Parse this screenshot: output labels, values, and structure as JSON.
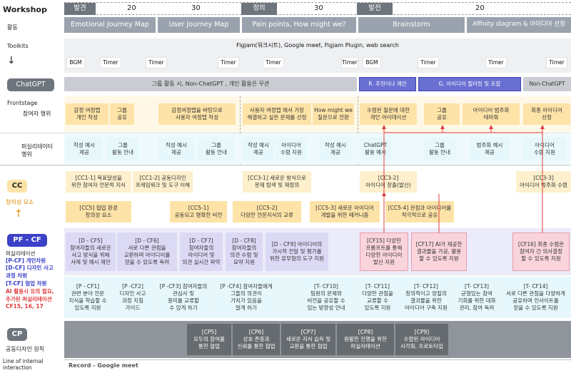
{
  "header": {
    "title": "Workshop",
    "timeline_label": "활동",
    "phases": [
      {
        "name": "발견",
        "minutes": "20",
        "minutes2": "30"
      },
      {
        "name": "정의",
        "minutes": "30"
      },
      {
        "name": "발전",
        "minutes": "20"
      }
    ],
    "activities": [
      "Emotional Journey Map",
      "User Journey Map",
      "Pain points, How might we?",
      "Brainstorm",
      "Affinity diagram & 아이디어 선정"
    ]
  },
  "toolkits": {
    "label": "Toolkits",
    "bar": "Figjam(워크시트), Google meet, Figjam Plugin, web search",
    "bgm": "BGM",
    "timer": "Timer"
  },
  "chatgpt": {
    "label": "ChatGPT",
    "bar": "그룹 활동 시, Non-ChatGPT , 개인 활용은 무관",
    "r": "R. 추천이나 제안",
    "g": "G. 아이디어 필터링 및 조합",
    "non": "Non-ChatGPT"
  },
  "frontstage": {
    "label": "Frontstage",
    "participant_label": "참여자 행위",
    "participant": [
      "감정 여정맵\n개인 작성",
      "그룹\n공유",
      "감정여정맵을 바탕으로\n사용자 여정맵 작성",
      "사용자 여정맵 에서 가장\n해결하고 싶은 문제를 선정",
      "How might we\n질문으로 전환",
      "수렴된 질문에 대한\n개인 아이데이션",
      "그룹\n공유",
      "아이디어 범주화\n테마화",
      "최종 아이디어\n선정"
    ],
    "facilitator_label": "퍼실리테이터\n행위",
    "facilitator": [
      "작성 예시\n제공",
      "그룹\n활동 안내",
      "작성 예시\n제공",
      "그룹\n활동 안내",
      "작성 예시\n제공",
      "아이디어\n수렴 지원",
      "작성 예시\n제공",
      "ChatGPT\n활용 예시",
      "그룹\n활동 안내",
      "범주화 예시\n제공",
      "아이디어\n수렴 지원"
    ]
  },
  "cc": {
    "label": "CC",
    "sublabel": "창의성 요소",
    "row1": [
      "[CC1-1] 목표달성을\n위한 참여자 전문적 지식",
      "[CC1-2] 공동디자인\n프레임워크 및 도구 이해",
      "[CC3-1] 새로운 방식으로\n문제 탐색 및 재정의",
      "[CC3-2]\n아이디어 창출(발산)",
      "[CC3-3]\n아이디어 범주화 수렴"
    ],
    "row2": [
      "[CC5] 협업 환경\n창의성 요소",
      "[CC5-1]\n공동되고 명확한 비전",
      "[CC5-2]\n다양한 전문지식의 교류",
      "[CC5-3] 새로운 아이디어\n개발을 위한 메커니즘",
      "[CC5-4] 관점과 아이디어를\n적극적으로 공유"
    ]
  },
  "pfcf": {
    "label": "PF - CF",
    "legend": [
      {
        "text": "퍼실리테이션",
        "color": "#333333"
      },
      {
        "text": "[P-CF] 개인차원",
        "color": "#3b40c9"
      },
      {
        "text": "[D-CF] 디자인 사고\n과정 차원",
        "color": "#3b40c9"
      },
      {
        "text": "[T-CF] 협업 차원",
        "color": "#3b40c9"
      },
      {
        "text": "AI 활용시 유의 필요,\n추가된 퍼실리테이션\nCF15, 16, 17",
        "color": "#e03c3c"
      }
    ],
    "dcf": [
      "[D - CF5]\n참여자들의 새로운\n사고 방식을 위해\n사례 및 예시 제안",
      "[D - CF6]\n서로 다른 관점을\n교환하며 아이디어를\n얻을 수 있도록 독려",
      "[D - CF7]\n참여자들의\n아이디어 및\n의견 실시간 파악",
      "[D - CF8]\n참여자들의\n의견 수렴 및\n요약 지원",
      "[D - CF9] 아이디어의\n가시적 전달 및 평가를\n위한 유무형의 도구 지원"
    ],
    "cf_ai": [
      "[CF15] 다양한\n프롬프트를 통해\n다양한 아이디어\n발산 지원",
      "[CF17] AI가 제공한\n결과물을 가공, 활용\n할 수 있도록 지원",
      "[CF16] 최종 수렴은\n참여자 간 의사결정\n할 수 있도록 지원"
    ],
    "pcf": [
      "[P - CF1]\n관련 분야 전문\n지식을 학습할 수\n있도록 지원",
      "[P -CF2]\n디자인 사고\n과정 지침\n가이드",
      "[P -CF3] 참여자들의\n관심사 및\n흥미를 교류할\n수 있게 하기",
      "[P -CF4] 참여자들에게\n그들의 의견이\n가치가 있음을\n알게 하기"
    ],
    "tcf": [
      "[T- CF10]\n팀원의 문제와\n비전을 공유할 수\n있는 방향성 안내",
      "[T- CF11]\n다양한 관점을\n교류할 수\n있도록 지원",
      "[T- CF12]\n창의적이고 양질의\n결과물을 위한\n아이디어 구축 지원",
      "[T- CF13]\n균형있는 참여\n기회를 위한 대화\n관리, 참여 독려",
      "[T- CF14]\n서로 다른 관점을 다양하게\n공유하며 인사이트를\n얻을 수 있도록 지원"
    ]
  },
  "cp": {
    "label": "CP",
    "sublabel": "공동디자인 원칙",
    "items": [
      "[CP5]\n모두의 참여를\n통한 협업",
      "[CP6]\n상호 존중과\n신뢰를 통한 협업",
      "[CP7]\n새로운 지식 습득 및\n교환을 통한 협업",
      "[CP8]\n원활한 진행을 위한\n퍼실리테이션",
      "[CP9]\n수렴된 아이디어\n시각화, 프로토타입"
    ]
  },
  "footer": {
    "line_label": "Line of internal\ninteraction",
    "record": "Record - Google meet"
  },
  "colors": {
    "accent_blue": "#3b40c9",
    "accent_red": "#e03c3c",
    "cc_yellow": "#fde3a7",
    "pink": "#f9d4dc"
  }
}
